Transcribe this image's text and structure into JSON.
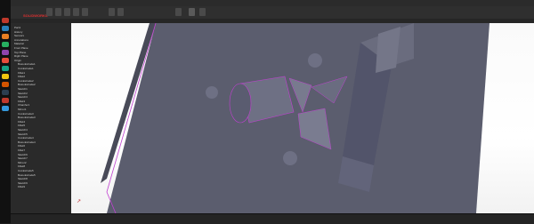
{
  "window": {
    "title": "",
    "brand": "SOLIDWORKS"
  },
  "colors": {
    "taskbar_icons": [
      "#c0392b",
      "#2980b9",
      "#e67e22",
      "#27ae60",
      "#8e44ad",
      "#e74c3c",
      "#16a085",
      "#f1c40f",
      "#d35400",
      "#2c3e50",
      "#c0392b",
      "#3498db"
    ],
    "part_body": "#5a5c6c",
    "part_edge": "#c040d0",
    "viewport_bg": "#ffffff"
  },
  "ribbon": {
    "buttons": [
      "features",
      "sketch",
      "evaluate",
      "dimxpert",
      "office"
    ]
  },
  "tree": {
    "items": [
      "Part1",
      "History",
      "Sensors",
      "Annotations",
      "Material",
      "Front Plane",
      "Top Plane",
      "Right Plane",
      "Origin",
      "Boss-Extrude1",
      "Cut-Extrude1",
      "Fillet1",
      "Fillet2",
      "Cut-Extrude2",
      "Boss-Extrude2",
      "Sketch1",
      "Sketch2",
      "Sketch3",
      "Fillet3",
      "Chamfer1",
      "Mirror1",
      "Cut-Extrude3",
      "Boss-Extrude3",
      "Fillet4",
      "Fillet5",
      "Sketch4",
      "Sketch5",
      "Cut-Extrude4",
      "Boss-Extrude4",
      "Fillet6",
      "Fillet7",
      "Sketch6",
      "Sketch7",
      "Mirror2",
      "Fillet8",
      "Cut-Extrude5",
      "Boss-Extrude5",
      "Sketch8",
      "Sketch9",
      "Fillet9"
    ]
  },
  "status": {
    "left": "",
    "right": ""
  }
}
